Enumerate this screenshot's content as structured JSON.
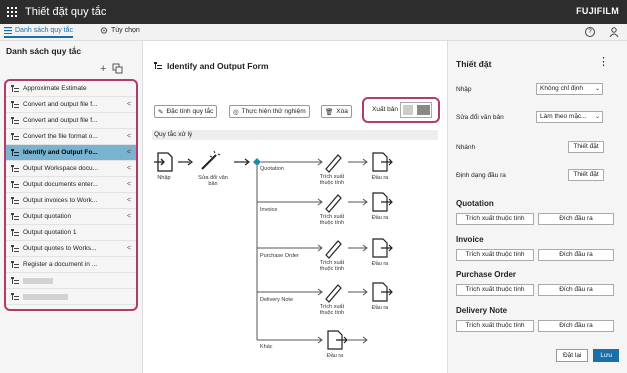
{
  "app": {
    "title": "Thiết đặt quy tắc",
    "brand": "FUJIFILM"
  },
  "tabs": [
    {
      "label": "Danh sách quy tắc"
    },
    {
      "label": "Tùy chọn"
    }
  ],
  "left": {
    "title": "Danh sách quy tắc",
    "items": [
      {
        "label": "Approximate Estimate",
        "shared": false
      },
      {
        "label": "Convert and output file f...",
        "shared": true
      },
      {
        "label": "Convert and output file f...",
        "shared": false
      },
      {
        "label": "Convert the file format o...",
        "shared": true
      },
      {
        "label": "Identify and Output Fo...",
        "shared": true
      },
      {
        "label": "Output Workspace docu...",
        "shared": true
      },
      {
        "label": "Output documents enter...",
        "shared": true
      },
      {
        "label": "Output invoices to Work...",
        "shared": true
      },
      {
        "label": "Output quotation",
        "shared": true
      },
      {
        "label": "Output quotation 1",
        "shared": false
      },
      {
        "label": "Output quotes to Works...",
        "shared": true
      },
      {
        "label": "Register a document in ...",
        "shared": false
      }
    ]
  },
  "center": {
    "title": "Identify and Output Form",
    "btn_props": "Đặc tính quy tắc",
    "btn_test": "Thực hiện thử nghiệm",
    "btn_delete": "Xóa",
    "publish": "Xuất bản",
    "flow_label": "Quy tắc xử lý",
    "input": "Nhập",
    "convert": "Sửa đổi văn bản",
    "branches": [
      "Quotation",
      "Invoice",
      "Purchase Order",
      "Delivery Note",
      "Khác"
    ],
    "extract": "Trích xuất thuộc tính",
    "output": "Đầu ra"
  },
  "right": {
    "title": "Thiết đặt",
    "input_label": "Nhập",
    "input_value": "Không chỉ định",
    "edit_label": "Sửa đổi văn bản",
    "edit_value": "Làm theo mặc...",
    "branch_label": "Nhánh",
    "branch_btn": "Thiết đặt",
    "format_label": "Định dạng đầu ra",
    "format_btn": "Thiết đặt",
    "sections": [
      "Quotation",
      "Invoice",
      "Purchase Order",
      "Delivery Note"
    ],
    "extract_btn": "Trích xuất thuộc tính",
    "output_btn": "Đích đầu ra",
    "reset": "Đặt lại",
    "save": "Lưu"
  }
}
